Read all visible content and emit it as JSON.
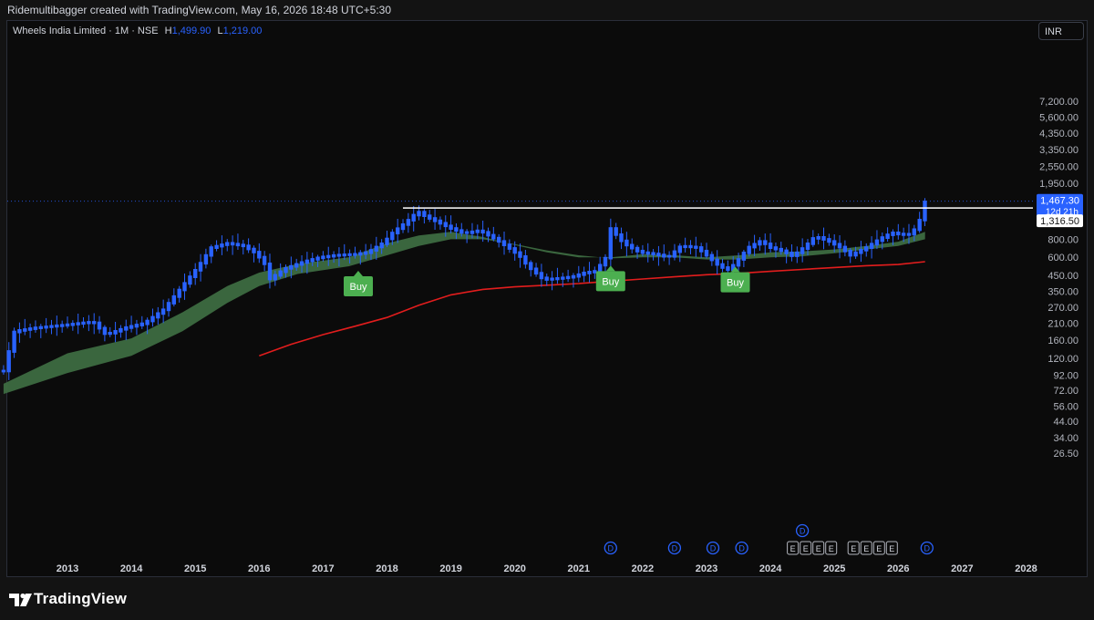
{
  "header": {
    "credit": "Ridemultibagger created with TradingView.com, May 16, 2026 18:48 UTC+5:30"
  },
  "legend": {
    "symbol": "Wheels India Limited · 1M · NSE",
    "h_label": "H",
    "h_value": "1,499.90",
    "l_label": "L",
    "l_value": "1,219.00"
  },
  "currency": "INR",
  "branding": {
    "name": "TradingView"
  },
  "price_labels": {
    "last": "1,467.30",
    "countdown": "12d 21h",
    "level": "1,316.50"
  },
  "signals": [
    {
      "label": "Buy",
      "date": 2017.55
    },
    {
      "label": "Buy",
      "date": 2021.5
    },
    {
      "label": "Buy",
      "date": 2023.45
    }
  ],
  "events": {
    "dividends": [
      2021.5,
      2022.5,
      2023.1,
      2023.55,
      2024.5,
      2026.45
    ],
    "earnings": [
      2024.35,
      2024.55,
      2024.75,
      2024.95,
      2025.3,
      2025.5,
      2025.7,
      2025.9
    ],
    "dividend_label": "D",
    "earnings_label": "E"
  },
  "colors": {
    "candle": "#2962ff",
    "ribbon": "#3d6b41",
    "ema_long": "#e21d1d",
    "buy": "#4caf50",
    "level_line": "#ffffff"
  },
  "chart_data": {
    "type": "candlestick",
    "scale": "log",
    "interval": "1M",
    "x_ticks": [
      "2013",
      "2014",
      "2015",
      "2016",
      "2017",
      "2018",
      "2019",
      "2020",
      "2021",
      "2022",
      "2023",
      "2024",
      "2025",
      "2026",
      "2027",
      "2028"
    ],
    "y_ticks": [
      "7,200.00",
      "5,600.00",
      "4,350.00",
      "3,350.00",
      "2,550.00",
      "1,950.00",
      "1,300.00",
      "1,050.00",
      "800.00",
      "600.00",
      "450.00",
      "350.00",
      "270.00",
      "210.00",
      "160.00",
      "120.00",
      "92.00",
      "72.00",
      "56.00",
      "44.00",
      "34.00",
      "26.50"
    ],
    "y_range": [
      24,
      9000
    ],
    "x_range": [
      2012.0,
      2028.2
    ],
    "anchors": [
      [
        2012.0,
        98
      ],
      [
        2012.17,
        185
      ],
      [
        2012.5,
        195
      ],
      [
        2013.0,
        205
      ],
      [
        2013.4,
        215
      ],
      [
        2013.6,
        175
      ],
      [
        2013.9,
        195
      ],
      [
        2014.2,
        210
      ],
      [
        2014.5,
        260
      ],
      [
        2014.8,
        380
      ],
      [
        2015.05,
        520
      ],
      [
        2015.25,
        700
      ],
      [
        2015.5,
        750
      ],
      [
        2015.75,
        720
      ],
      [
        2015.95,
        640
      ],
      [
        2016.1,
        530
      ],
      [
        2016.15,
        420
      ],
      [
        2016.4,
        500
      ],
      [
        2016.7,
        560
      ],
      [
        2016.95,
        600
      ],
      [
        2017.2,
        620
      ],
      [
        2017.5,
        630
      ],
      [
        2017.7,
        650
      ],
      [
        2017.95,
        760
      ],
      [
        2018.1,
        900
      ],
      [
        2018.3,
        1050
      ],
      [
        2018.48,
        1250
      ],
      [
        2018.6,
        1150
      ],
      [
        2018.8,
        1050
      ],
      [
        2019.0,
        950
      ],
      [
        2019.2,
        880
      ],
      [
        2019.45,
        920
      ],
      [
        2019.7,
        800
      ],
      [
        2019.9,
        700
      ],
      [
        2020.1,
        600
      ],
      [
        2020.2,
        520
      ],
      [
        2020.3,
        480
      ],
      [
        2020.45,
        420
      ],
      [
        2020.7,
        430
      ],
      [
        2020.9,
        440
      ],
      [
        2021.1,
        470
      ],
      [
        2021.25,
        480
      ],
      [
        2021.35,
        540
      ],
      [
        2021.45,
        620
      ],
      [
        2021.5,
        950
      ],
      [
        2021.7,
        750
      ],
      [
        2021.95,
        650
      ],
      [
        2022.2,
        630
      ],
      [
        2022.4,
        600
      ],
      [
        2022.6,
        720
      ],
      [
        2022.85,
        700
      ],
      [
        2023.0,
        620
      ],
      [
        2023.2,
        520
      ],
      [
        2023.35,
        490
      ],
      [
        2023.5,
        580
      ],
      [
        2023.65,
        700
      ],
      [
        2023.85,
        780
      ],
      [
        2024.0,
        700
      ],
      [
        2024.2,
        660
      ],
      [
        2024.35,
        610
      ],
      [
        2024.55,
        720
      ],
      [
        2024.7,
        840
      ],
      [
        2024.9,
        780
      ],
      [
        2025.1,
        700
      ],
      [
        2025.25,
        620
      ],
      [
        2025.5,
        700
      ],
      [
        2025.7,
        800
      ],
      [
        2025.9,
        890
      ],
      [
        2026.05,
        860
      ],
      [
        2026.2,
        870
      ],
      [
        2026.3,
        1000
      ],
      [
        2026.38,
        1220
      ],
      [
        2026.42,
        1470
      ]
    ],
    "ribbon_upper": [
      [
        2012.0,
        80
      ],
      [
        2013.0,
        130
      ],
      [
        2014.0,
        165
      ],
      [
        2014.8,
        250
      ],
      [
        2015.5,
        380
      ],
      [
        2016.0,
        470
      ],
      [
        2016.6,
        540
      ],
      [
        2017.4,
        600
      ],
      [
        2018.0,
        750
      ],
      [
        2018.5,
        850
      ],
      [
        2019.0,
        900
      ],
      [
        2019.5,
        830
      ],
      [
        2020.0,
        730
      ],
      [
        2020.5,
        650
      ],
      [
        2021.0,
        600
      ],
      [
        2021.5,
        600
      ],
      [
        2022.0,
        630
      ],
      [
        2022.5,
        620
      ],
      [
        2023.0,
        600
      ],
      [
        2023.5,
        620
      ],
      [
        2024.0,
        650
      ],
      [
        2024.5,
        660
      ],
      [
        2025.0,
        680
      ],
      [
        2025.5,
        720
      ],
      [
        2026.0,
        770
      ],
      [
        2026.42,
        900
      ]
    ],
    "ribbon_lower": [
      [
        2012.0,
        68
      ],
      [
        2013.0,
        95
      ],
      [
        2014.0,
        125
      ],
      [
        2014.8,
        185
      ],
      [
        2015.5,
        290
      ],
      [
        2016.0,
        380
      ],
      [
        2016.6,
        460
      ],
      [
        2017.4,
        520
      ],
      [
        2018.0,
        620
      ],
      [
        2018.5,
        720
      ],
      [
        2019.0,
        800
      ],
      [
        2019.5,
        800
      ],
      [
        2020.0,
        740
      ],
      [
        2020.5,
        670
      ],
      [
        2021.0,
        620
      ],
      [
        2021.5,
        590
      ],
      [
        2022.0,
        600
      ],
      [
        2022.5,
        600
      ],
      [
        2023.0,
        580
      ],
      [
        2023.5,
        580
      ],
      [
        2024.0,
        600
      ],
      [
        2024.5,
        610
      ],
      [
        2025.0,
        640
      ],
      [
        2025.5,
        680
      ],
      [
        2026.0,
        720
      ],
      [
        2026.42,
        800
      ]
    ],
    "ema_long": [
      [
        2016.0,
        125
      ],
      [
        2016.5,
        150
      ],
      [
        2017.0,
        175
      ],
      [
        2017.5,
        200
      ],
      [
        2018.0,
        230
      ],
      [
        2018.5,
        280
      ],
      [
        2019.0,
        330
      ],
      [
        2019.5,
        360
      ],
      [
        2020.0,
        375
      ],
      [
        2020.5,
        385
      ],
      [
        2021.0,
        395
      ],
      [
        2021.5,
        410
      ],
      [
        2022.0,
        425
      ],
      [
        2022.5,
        440
      ],
      [
        2023.0,
        455
      ],
      [
        2023.5,
        465
      ],
      [
        2024.0,
        480
      ],
      [
        2024.5,
        495
      ],
      [
        2025.0,
        510
      ],
      [
        2025.5,
        525
      ],
      [
        2026.0,
        535
      ],
      [
        2026.42,
        560
      ]
    ],
    "horizontal_line": {
      "value": 1316.5,
      "from": 2018.25
    },
    "last_price": 1467.3,
    "high": 1499.9,
    "low": 1219.0
  }
}
